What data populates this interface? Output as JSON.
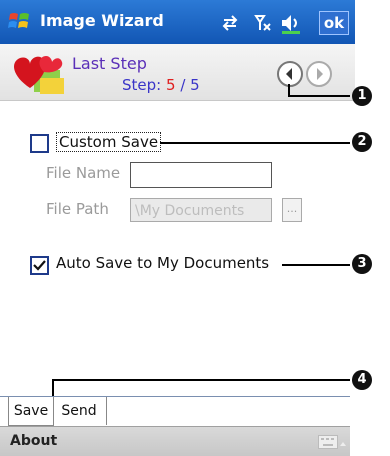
{
  "title_bar": {
    "app_title": "Image Wizard",
    "ok_label": "ok",
    "status_icons": [
      "connectivity-icon",
      "signal-off-icon",
      "volume-icon"
    ]
  },
  "header": {
    "step_title": "Last Step",
    "step_prefix": "Step:",
    "step_current": "5",
    "step_separator": " / ",
    "step_total": "5"
  },
  "custom_save": {
    "checkbox_label": "Custom Save",
    "checked": false,
    "file_name_label": "File Name",
    "file_name_value": "",
    "file_path_label": "File Path",
    "file_path_value": "\\My Documents",
    "browse_label": "..."
  },
  "auto_save": {
    "checkbox_label": "Auto Save to My Documents",
    "checked": true
  },
  "tabs": [
    {
      "label": "Save",
      "active": true
    },
    {
      "label": "Send",
      "active": false
    }
  ],
  "menu": {
    "left_label": "About"
  },
  "callouts": [
    "1",
    "2",
    "3",
    "4"
  ],
  "colors": {
    "title_bar": "#1a63c4",
    "step_title": "#5a2fb8",
    "step_current": "#e02020",
    "step_info": "#3a35c8"
  }
}
